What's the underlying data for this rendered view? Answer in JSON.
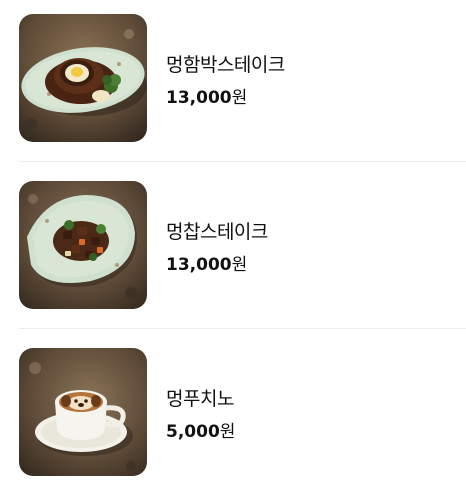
{
  "menu": {
    "items": [
      {
        "name": "멍함박스테이크",
        "price": "13,000",
        "currency": "원",
        "image_icon": "hamburg-steak-plate-image"
      },
      {
        "name": "멍찹스테이크",
        "price": "13,000",
        "currency": "원",
        "image_icon": "chop-steak-plate-image"
      },
      {
        "name": "멍푸치노",
        "price": "5,000",
        "currency": "원",
        "image_icon": "dog-latte-cup-image"
      }
    ]
  },
  "colors": {
    "ground": "#6b5540",
    "plate": "#c9dccb",
    "text": "#111111",
    "divider": "#ececec"
  }
}
